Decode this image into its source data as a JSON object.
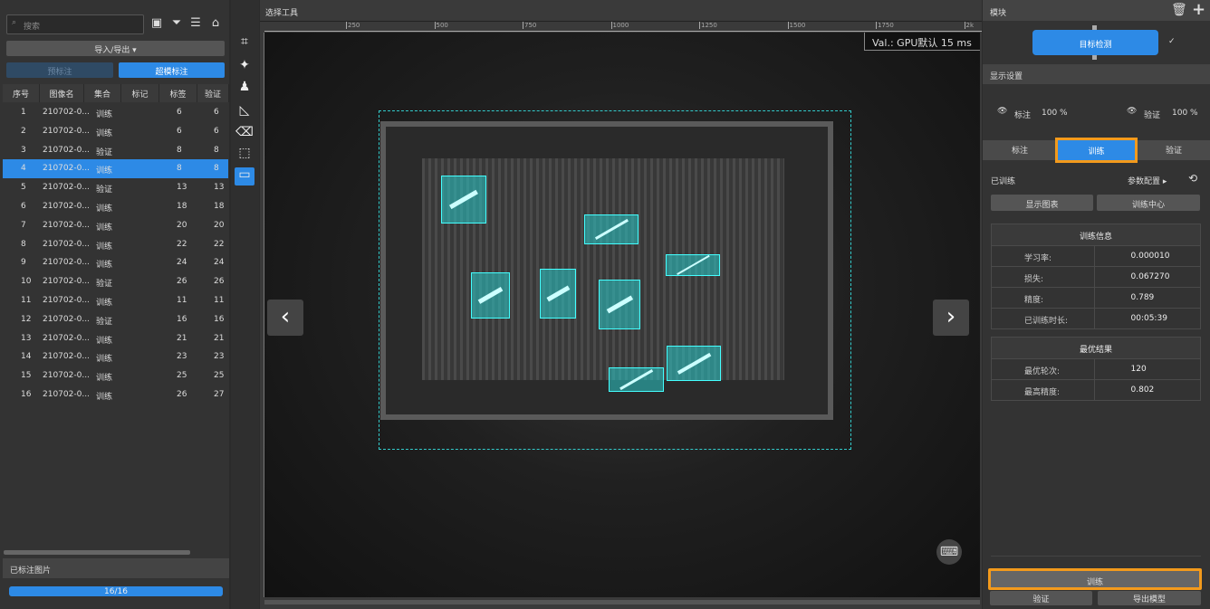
{
  "left": {
    "search_placeholder": "搜索",
    "import_export": "导入/导出 ▾",
    "pre_label": "预标注",
    "super_label": "超模标注",
    "columns": [
      "序号",
      "图像名",
      "集合",
      "标记",
      "标签",
      "验证"
    ],
    "rows": [
      {
        "n": "1",
        "name": "210702-0...",
        "set": "训练",
        "tags": "6",
        "val": "6"
      },
      {
        "n": "2",
        "name": "210702-0...",
        "set": "训练",
        "tags": "6",
        "val": "6"
      },
      {
        "n": "3",
        "name": "210702-0...",
        "set": "验证",
        "tags": "8",
        "val": "8"
      },
      {
        "n": "4",
        "name": "210702-0...",
        "set": "训练",
        "tags": "8",
        "val": "8"
      },
      {
        "n": "5",
        "name": "210702-0...",
        "set": "验证",
        "tags": "13",
        "val": "13"
      },
      {
        "n": "6",
        "name": "210702-0...",
        "set": "训练",
        "tags": "18",
        "val": "18"
      },
      {
        "n": "7",
        "name": "210702-0...",
        "set": "训练",
        "tags": "20",
        "val": "20"
      },
      {
        "n": "8",
        "name": "210702-0...",
        "set": "训练",
        "tags": "22",
        "val": "22"
      },
      {
        "n": "9",
        "name": "210702-0...",
        "set": "训练",
        "tags": "24",
        "val": "24"
      },
      {
        "n": "10",
        "name": "210702-0...",
        "set": "验证",
        "tags": "26",
        "val": "26"
      },
      {
        "n": "11",
        "name": "210702-0...",
        "set": "训练",
        "tags": "11",
        "val": "11"
      },
      {
        "n": "12",
        "name": "210702-0...",
        "set": "验证",
        "tags": "16",
        "val": "16"
      },
      {
        "n": "13",
        "name": "210702-0...",
        "set": "训练",
        "tags": "21",
        "val": "21"
      },
      {
        "n": "14",
        "name": "210702-0...",
        "set": "训练",
        "tags": "23",
        "val": "23"
      },
      {
        "n": "15",
        "name": "210702-0...",
        "set": "训练",
        "tags": "25",
        "val": "25"
      },
      {
        "n": "16",
        "name": "210702-0...",
        "set": "训练",
        "tags": "26",
        "val": "27"
      }
    ],
    "selected_row": 4,
    "labeled_title": "已标注图片",
    "progress_text": "16/16",
    "progress": 1.0
  },
  "canvas": {
    "title": "选择工具",
    "ruler": [
      "250",
      "500",
      "750",
      "1000",
      "1250",
      "1500",
      "1750",
      "2k"
    ],
    "val_label": "Val.:",
    "val_text": "GPU默认 15 ms"
  },
  "right": {
    "module_title": "模块",
    "module_name": "目标检测",
    "display_title": "显示设置",
    "annot": "标注",
    "annot_pct": "100  %",
    "verify": "验证",
    "verify_pct": "100  %",
    "tabs": [
      "标注",
      "训练",
      "验证"
    ],
    "active_tab": "训练",
    "trained": "已训练",
    "param": "参数配置 ▸",
    "show_chart": "显示图表",
    "train_center": "训练中心",
    "info_title": "训练信息",
    "info": [
      {
        "k": "学习率:",
        "v": "0.000010"
      },
      {
        "k": "损失:",
        "v": "0.067270"
      },
      {
        "k": "精度:",
        "v": "0.789"
      },
      {
        "k": "已训练时长:",
        "v": "00:05:39"
      }
    ],
    "best_title": "最优结果",
    "best": [
      {
        "k": "最优轮次:",
        "v": "120"
      },
      {
        "k": "最高精度:",
        "v": "0.802"
      }
    ],
    "train_btn": "训练",
    "verify_btn": "验证",
    "export_btn": "导出模型"
  },
  "colors": {
    "accent": "#2d8ae6",
    "highlight": "#f39a1c",
    "detection": "#44ffff"
  }
}
